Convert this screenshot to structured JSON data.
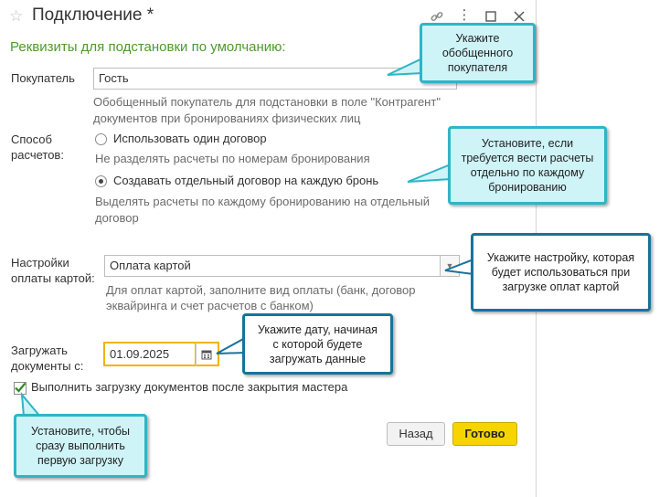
{
  "window": {
    "title": "Подключение *"
  },
  "section_title": "Реквизиты для подстановки по умолчанию:",
  "buyer": {
    "label": "Покупатель",
    "value": "Гость",
    "hint_line1": "Обобщенный покупатель для подстановки в поле \"Контрагент\"",
    "hint_line2": "документов при бронированиях физических лиц"
  },
  "payment": {
    "label_line1": "Способ",
    "label_line2": "расчетов:",
    "option1": "Использовать один договор",
    "option1_hint": "Не разделять расчеты по номерам бронирования",
    "option2": "Создавать отдельный договор на каждую бронь",
    "option2_hint_line1": "Выделять расчеты по каждому бронированию на отдельный",
    "option2_hint_line2": "договор",
    "selected": "option2"
  },
  "card": {
    "label_line1": "Настройки",
    "label_line2": "оплаты картой:",
    "value": "Оплата картой",
    "hint_line1": "Для оплат картой, заполните вид оплаты (банк, договор",
    "hint_line2": "эквайринга и счет расчетов с банком)"
  },
  "load": {
    "label_line1": "Загружать",
    "label_line2": "документы с:",
    "date": "01.09.2025"
  },
  "checkbox": {
    "label": "Выполнить загрузку документов после закрытия мастера",
    "checked": true
  },
  "buttons": {
    "back": "Назад",
    "done": "Готово"
  },
  "tips": {
    "buyer": [
      "Укажите",
      "обобщенного",
      "покупателя"
    ],
    "payment": [
      "Установите, если",
      "требуется вести расчеты",
      "отдельно по каждому",
      "бронированию"
    ],
    "card": [
      "Укажите настройку, которая",
      "будет использоваться при",
      "загрузке оплат картой"
    ],
    "date": [
      "Укажите дату, начиная",
      "с которой будете",
      "загружать данные"
    ],
    "checkbox": [
      "Установите, чтобы",
      "сразу выполнить",
      "первую загрузку"
    ]
  },
  "colors": {
    "accent_green": "#4e9a2c",
    "tip_fill": "#cff4f8",
    "tip_border": "#2fb5c6",
    "tip_border_dark": "#18739b",
    "done_yellow": "#f5d400",
    "date_border": "#f0b400"
  }
}
